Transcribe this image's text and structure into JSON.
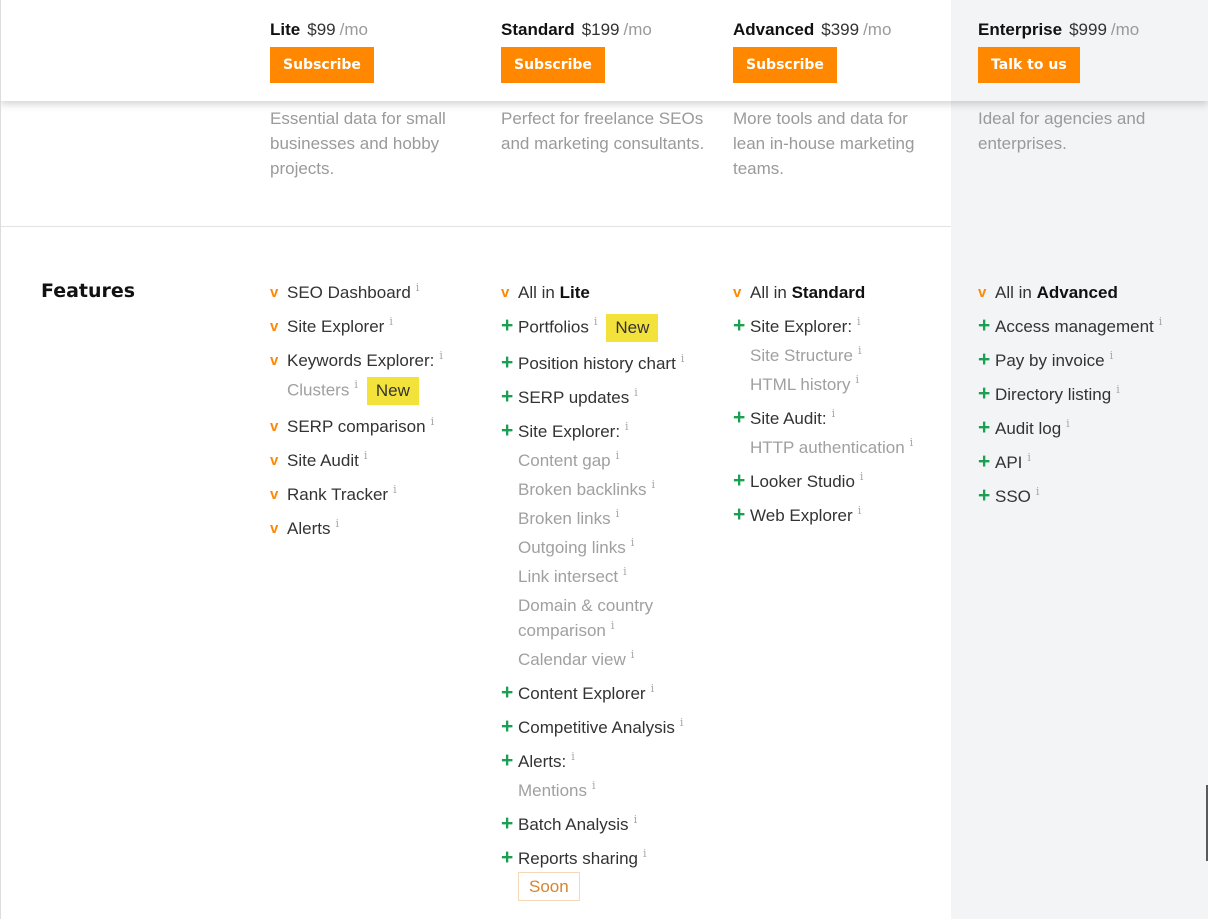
{
  "plans": [
    {
      "name": "Lite",
      "price": "$99",
      "per": "/mo",
      "button": "Subscribe",
      "description": "Essential data for small businesses and hobby projects."
    },
    {
      "name": "Standard",
      "price": "$199",
      "per": "/mo",
      "button": "Subscribe",
      "description": "Perfect for freelance SEOs and marketing consultants."
    },
    {
      "name": "Advanced",
      "price": "$399",
      "per": "/mo",
      "button": "Subscribe",
      "description": "More tools and data for lean in-house marketing teams."
    },
    {
      "name": "Enterprise",
      "price": "$999",
      "per": "/mo",
      "button": "Talk to us",
      "description": "Ideal for agencies and enterprises."
    }
  ],
  "features": {
    "title": "Features",
    "info_glyph": "i",
    "check_glyph": "v",
    "plus_glyph": "+",
    "lite": {
      "items": [
        "SEO Dashboard",
        "Site Explorer",
        "Keywords Explorer:",
        "SERP comparison",
        "Site Audit",
        "Rank Tracker",
        "Alerts"
      ],
      "clusters": "Clusters",
      "new_badge": "New"
    },
    "standard": {
      "all_in_prefix": "All in",
      "all_in_plan": "Lite",
      "portfolios": "Portfolios",
      "new_badge": "New",
      "position_history": "Position history chart",
      "serp_updates": "SERP updates",
      "site_explorer": "Site Explorer:",
      "site_explorer_subs": [
        "Content gap",
        "Broken backlinks",
        "Broken links",
        "Outgoing links",
        "Link intersect",
        "Domain & country comparison",
        "Calendar view"
      ],
      "content_explorer": "Content Explorer",
      "competitive_analysis": "Competitive Analysis",
      "alerts": "Alerts:",
      "mentions": "Mentions",
      "batch_analysis": "Batch Analysis",
      "reports_sharing": "Reports sharing",
      "soon_badge": "Soon"
    },
    "advanced": {
      "all_in_prefix": "All in",
      "all_in_plan": "Standard",
      "site_explorer": "Site Explorer:",
      "site_explorer_subs": [
        "Site Structure",
        "HTML history"
      ],
      "site_audit": "Site Audit:",
      "site_audit_subs": [
        "HTTP authentication"
      ],
      "looker_studio": "Looker Studio",
      "web_explorer": "Web Explorer"
    },
    "enterprise": {
      "all_in_prefix": "All in",
      "all_in_plan": "Advanced",
      "items": [
        "Access management",
        "Pay by invoice",
        "Directory listing",
        "Audit log",
        "API",
        "SSO"
      ]
    }
  },
  "colors": {
    "accent": "#ff8800",
    "plus": "#1a9f53",
    "new_badge": "#f3e23a",
    "enterprise_bg": "#f3f4f6"
  }
}
